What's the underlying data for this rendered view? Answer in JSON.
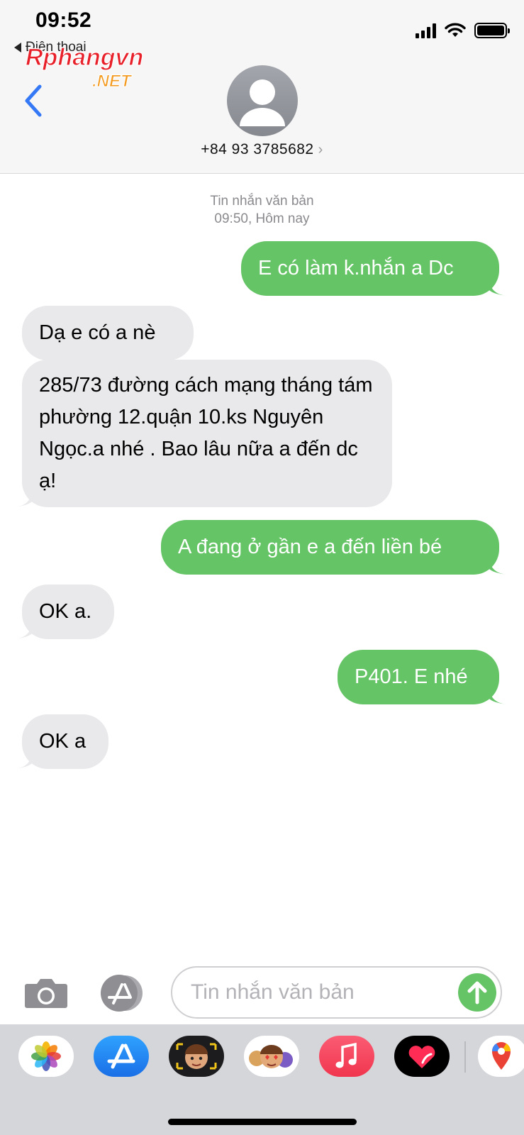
{
  "status_bar": {
    "time": "09:52",
    "back_app": "Điện thoại"
  },
  "watermark": {
    "line1": "Rphangvn",
    "line2": ".NET"
  },
  "header": {
    "contact": "+84 93 3785682"
  },
  "thread": {
    "meta_line1": "Tin nhắn văn bản",
    "meta_line2": "09:50, Hôm nay",
    "messages": [
      {
        "dir": "out",
        "text": "E có làm k.nhắn a Dc"
      },
      {
        "dir": "in",
        "text": "Dạ e có a nè"
      },
      {
        "dir": "in",
        "text": "285/73 đường cách mạng tháng tám phường 12.quận 10.ks Nguyên Ngọc.a nhé . Bao lâu nữa a đến dc ạ!"
      },
      {
        "dir": "out",
        "text": "A đang ở gần e a đến liền bé"
      },
      {
        "dir": "in",
        "text": "OK a."
      },
      {
        "dir": "out",
        "text": "P401. E nhé"
      },
      {
        "dir": "in",
        "text": "OK a"
      }
    ]
  },
  "compose": {
    "placeholder": "Tin nhắn văn bản"
  },
  "app_drawer": [
    {
      "icon": "photos-icon"
    },
    {
      "icon": "app-store-icon"
    },
    {
      "icon": "memoji-icon"
    },
    {
      "icon": "memoji-stickers-icon"
    },
    {
      "icon": "music-icon"
    },
    {
      "icon": "digital-touch-icon"
    },
    {
      "icon": "maps-icon"
    }
  ],
  "colors": {
    "sent_bubble": "#65c466",
    "received_bubble": "#e9e9eb",
    "accent": "#3478f6"
  }
}
